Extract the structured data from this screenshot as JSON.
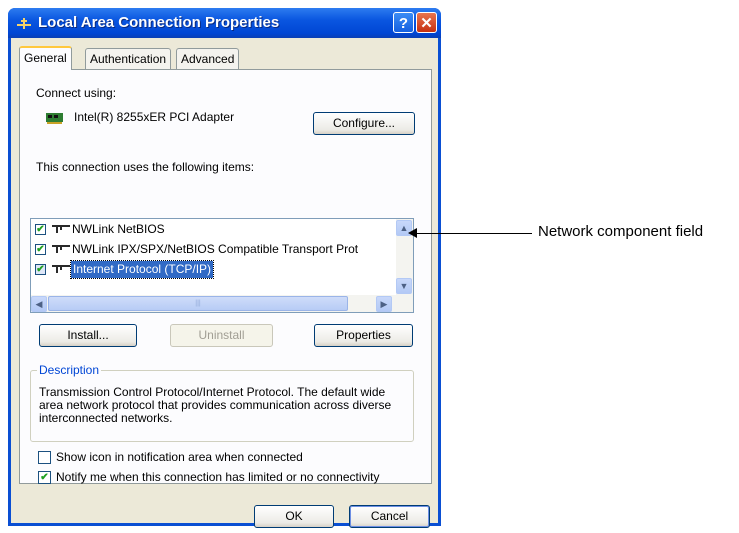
{
  "window": {
    "title": "Local Area Connection Properties",
    "help_label": "?",
    "close_label": "✕"
  },
  "tabs": [
    {
      "label": "General",
      "selected": true
    },
    {
      "label": "Authentication",
      "selected": false
    },
    {
      "label": "Advanced",
      "selected": false
    }
  ],
  "general": {
    "connect_using_label": "Connect using:",
    "adapter_name": "Intel(R) 8255xER PCI Adapter",
    "configure_label": "Configure...",
    "items_label": "This connection uses the following items:",
    "items": [
      {
        "label": "NWLink NetBIOS",
        "checked": true
      },
      {
        "label": "NWLink IPX/SPX/NetBIOS Compatible Transport Prot",
        "checked": true
      },
      {
        "label": "Internet Protocol (TCP/IP)",
        "checked": true,
        "selected": true
      }
    ],
    "install_label": "Install...",
    "uninstall_label": "Uninstall",
    "properties_label": "Properties",
    "description_title": "Description",
    "description_text": "Transmission Control Protocol/Internet Protocol. The default wide area network protocol that provides communication across diverse interconnected networks.",
    "show_icon_label": "Show icon in notification area when connected",
    "show_icon_checked": false,
    "notify_label": "Notify me when this connection has limited or no connectivity",
    "notify_checked": true
  },
  "footer": {
    "ok_label": "OK",
    "cancel_label": "Cancel"
  },
  "callout": {
    "label": "Network component field"
  },
  "colors": {
    "titlebar": "#0a56e0",
    "selection": "#316ac5",
    "group_title": "#0046d5"
  }
}
